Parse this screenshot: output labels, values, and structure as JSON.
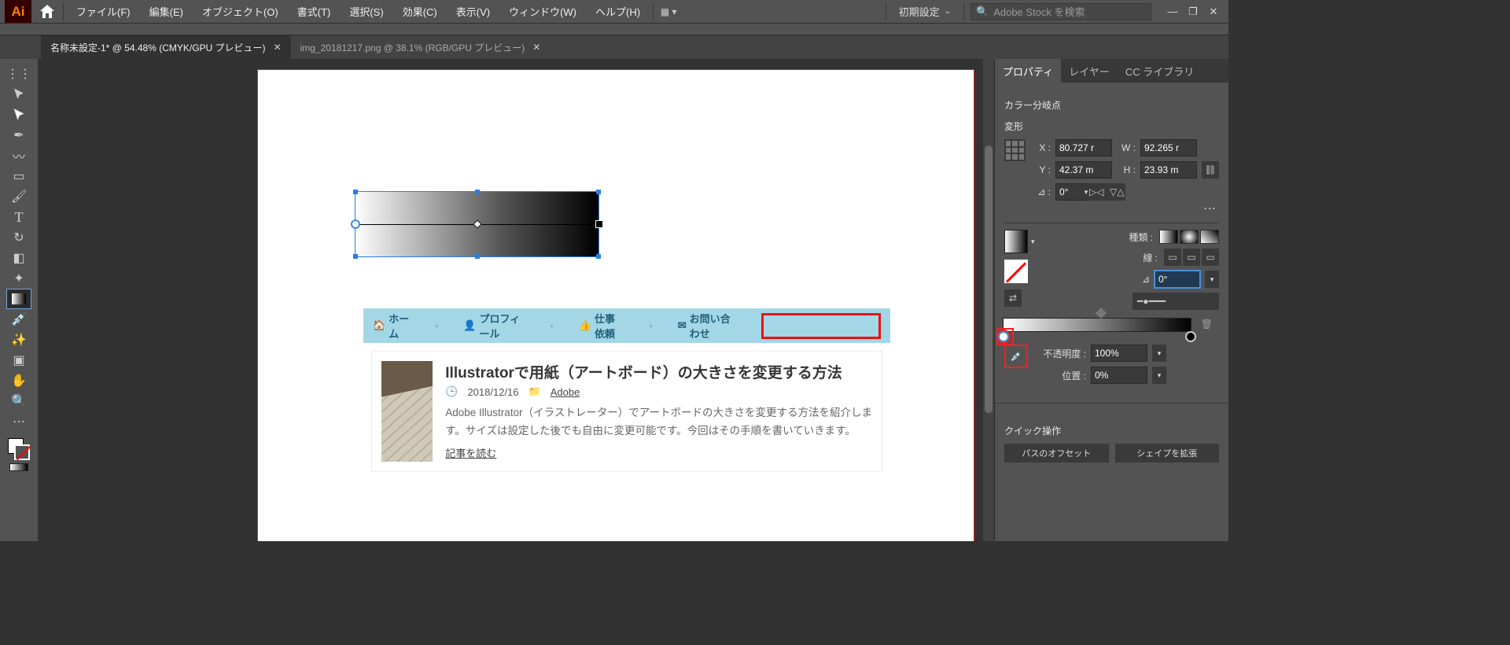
{
  "menubar": {
    "logo": "Ai",
    "items": [
      "ファイル(F)",
      "編集(E)",
      "オブジェクト(O)",
      "書式(T)",
      "選択(S)",
      "効果(C)",
      "表示(V)",
      "ウィンドウ(W)",
      "ヘルプ(H)"
    ],
    "workspace": "初期設定",
    "search_placeholder": "Adobe Stock を検索"
  },
  "tabs": [
    {
      "label": "名称未設定-1* @ 54.48% (CMYK/GPU プレビュー)",
      "active": true
    },
    {
      "label": "img_20181217.png @ 38.1% (RGB/GPU プレビュー)",
      "active": false
    }
  ],
  "panels": {
    "tabs": [
      "プロパティ",
      "レイヤー",
      "CC ライブラリ"
    ],
    "section_appearance": "カラー分岐点",
    "transform": {
      "title": "変形",
      "x_label": "X :",
      "x": "80.727 r",
      "y_label": "Y :",
      "y": "42.37 m",
      "w_label": "W :",
      "w": "92.265 r",
      "h_label": "H :",
      "h": "23.93 m",
      "angle_label": "⊿ :",
      "angle": "0°"
    },
    "gradient": {
      "type_label": "種類 :",
      "stroke_label": "線 :",
      "angle_label_icon": "⊿",
      "angle_value": "0°",
      "opacity_label": "不透明度 :",
      "opacity_value": "100%",
      "position_label": "位置 :",
      "position_value": "0%"
    },
    "quick": {
      "title": "クイック操作",
      "btn1": "パスのオフセット",
      "btn2": "シェイプを拡張"
    }
  },
  "mock": {
    "nav": [
      "ホーム",
      "プロフィール",
      "仕事依頼",
      "お問い合わせ"
    ],
    "title": "Illustratorで用紙（アートボード）の大きさを変更する方法",
    "date": "2018/12/16",
    "cat": "Adobe",
    "excerpt": "Adobe Illustrator（イラストレーター）でアートボードの大きさを変更する方法を紹介します。サイズは設定した後でも自由に変更可能です。今回はその手順を書いていきます。",
    "readmore": "記事を読む"
  }
}
